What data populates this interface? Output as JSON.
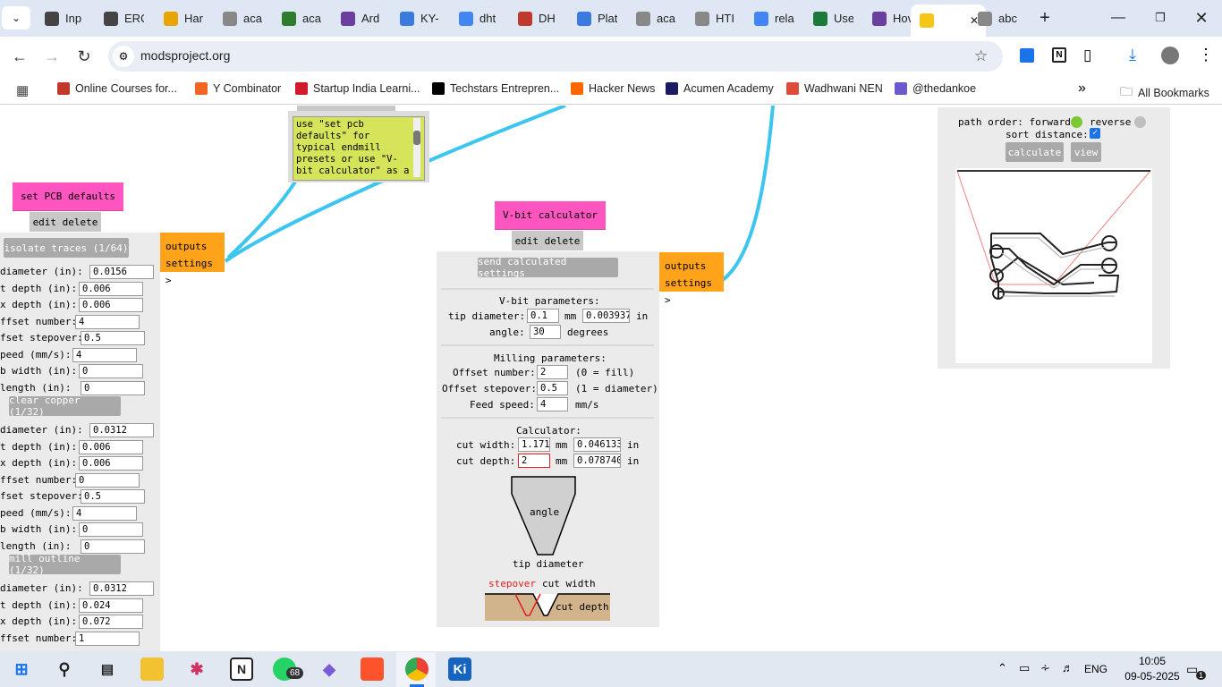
{
  "browser": {
    "tabs": [
      {
        "label": "Inp",
        "icon": "openai-icon",
        "color": "#444"
      },
      {
        "label": "ERC",
        "icon": "openai-icon",
        "color": "#444"
      },
      {
        "label": "Har",
        "icon": "grid-icon",
        "color": "#e8a400"
      },
      {
        "label": "aca",
        "icon": "generic-globe-icon",
        "color": "#888"
      },
      {
        "label": "aca",
        "icon": "puzzle-icon",
        "color": "#2d7d2d"
      },
      {
        "label": "Ard",
        "icon": "k-icon",
        "color": "#6b3fa0"
      },
      {
        "label": "KY-",
        "icon": "k-icon",
        "color": "#3b7be0"
      },
      {
        "label": "dht",
        "icon": "google-icon",
        "color": "#4285f4"
      },
      {
        "label": "DH",
        "icon": "e-icon",
        "color": "#c0392b"
      },
      {
        "label": "Plat",
        "icon": "k-icon",
        "color": "#3b7be0"
      },
      {
        "label": "aca",
        "icon": "generic-globe-icon",
        "color": "#888"
      },
      {
        "label": "HTI",
        "icon": "generic-globe-icon",
        "color": "#888"
      },
      {
        "label": "rela",
        "icon": "google-icon",
        "color": "#4285f4"
      },
      {
        "label": "Use",
        "icon": "globe-icon",
        "color": "#1a7a3a"
      },
      {
        "label": "Hov",
        "icon": "k-icon",
        "color": "#6b3fa0"
      },
      {
        "label": "",
        "icon": "sunglasses-icon",
        "color": "#f5c518",
        "active": true
      },
      {
        "label": "abc",
        "icon": "generic-globe-icon",
        "color": "#888"
      }
    ],
    "url": "modsproject.org",
    "bookmarks": [
      {
        "label": "Online Courses for...",
        "color": "#c0392b"
      },
      {
        "label": "Y Combinator",
        "color": "#f26522"
      },
      {
        "label": "Startup India Learni...",
        "color": "#d11a2a"
      },
      {
        "label": "Techstars Entrepren...",
        "color": "#000"
      },
      {
        "label": "Hacker News",
        "color": "#ff6600"
      },
      {
        "label": "Acumen Academy",
        "color": "#1a1a60"
      },
      {
        "label": "Wadhwani NEN",
        "color": "#e04a3a"
      },
      {
        "label": "@thedankoe",
        "color": "#6a5acd"
      }
    ],
    "all_bookmarks": "All Bookmarks"
  },
  "note": {
    "text": "use \"set pcb defaults\" for typical endmill presets or use \"V-bit calculator\" as a"
  },
  "set_pcb": {
    "title": "set PCB defaults",
    "edit_delete": "edit delete",
    "outputs": "outputs",
    "settings": "settings >",
    "sections": [
      {
        "button": "isolate traces (1/64)",
        "rows": [
          {
            "label": "diameter (in):",
            "value": "0.0156"
          },
          {
            "label": "t depth (in):",
            "value": "0.006"
          },
          {
            "label": "x depth (in):",
            "value": "0.006"
          },
          {
            "label": "ffset number:",
            "value": "4"
          },
          {
            "label": "fset stepover:",
            "value": "0.5"
          },
          {
            "label": "peed (mm/s):",
            "value": "4"
          },
          {
            "label": "b width (in):",
            "value": "0"
          },
          {
            "label": "length (in):",
            "value": "0"
          }
        ]
      },
      {
        "button": "clear copper (1/32)",
        "rows": [
          {
            "label": "diameter (in):",
            "value": "0.0312"
          },
          {
            "label": "t depth (in):",
            "value": "0.006"
          },
          {
            "label": "x depth (in):",
            "value": "0.006"
          },
          {
            "label": "ffset number:",
            "value": "0"
          },
          {
            "label": "fset stepover:",
            "value": "0.5"
          },
          {
            "label": "peed (mm/s):",
            "value": "4"
          },
          {
            "label": "b width (in):",
            "value": "0"
          },
          {
            "label": "length (in):",
            "value": "0"
          }
        ]
      },
      {
        "button": "mill outline (1/32)",
        "rows": [
          {
            "label": "diameter (in):",
            "value": "0.0312"
          },
          {
            "label": "t depth (in):",
            "value": "0.024"
          },
          {
            "label": "x depth (in):",
            "value": "0.072"
          },
          {
            "label": "ffset number:",
            "value": "1"
          }
        ]
      }
    ]
  },
  "vbit": {
    "title": "V-bit calculator",
    "edit_delete": "edit delete",
    "send_button": "send calculated settings",
    "outputs": "outputs",
    "settings": "settings >",
    "vbit_heading": "V-bit parameters:",
    "tip_label": "tip diameter:",
    "tip_mm": "0.1",
    "mm": "mm",
    "tip_in": "0.003937",
    "in": "in",
    "angle_label": "angle:",
    "angle_value": "30",
    "degrees": "degrees",
    "milling_heading": "Milling parameters:",
    "offset_number_label": "Offset number:",
    "offset_number_value": "2",
    "offset_number_note": "(0 = fill)",
    "offset_stepover_label": "Offset stepover:",
    "offset_stepover_value": "0.5",
    "offset_stepover_note": "(1 = diameter)",
    "feed_label": "Feed speed:",
    "feed_value": "4",
    "feed_unit": "mm/s",
    "calc_heading": "Calculator:",
    "cut_width_label": "cut width:",
    "cut_width_mm": "1.171",
    "cut_width_in": "0.046133",
    "cut_depth_label": "cut depth:",
    "cut_depth_mm": "2",
    "cut_depth_in": "0.078740",
    "diagram_angle": "angle",
    "diagram_tip": "tip diameter",
    "diagram_stepover": "stepover",
    "diagram_cut_width": "cut width",
    "diagram_cut_depth": "cut depth"
  },
  "path": {
    "order_label": "path order: forward",
    "reverse_label": "reverse",
    "sort_label": "sort distance:",
    "calculate": "calculate",
    "view": "view",
    "forward_color": "#7cc832",
    "reverse_color": "#bfbfbf"
  },
  "taskbar": {
    "whatsapp_badge": "68",
    "lang": "ENG",
    "time": "10:05",
    "date": "09-05-2025",
    "notif": "1"
  }
}
